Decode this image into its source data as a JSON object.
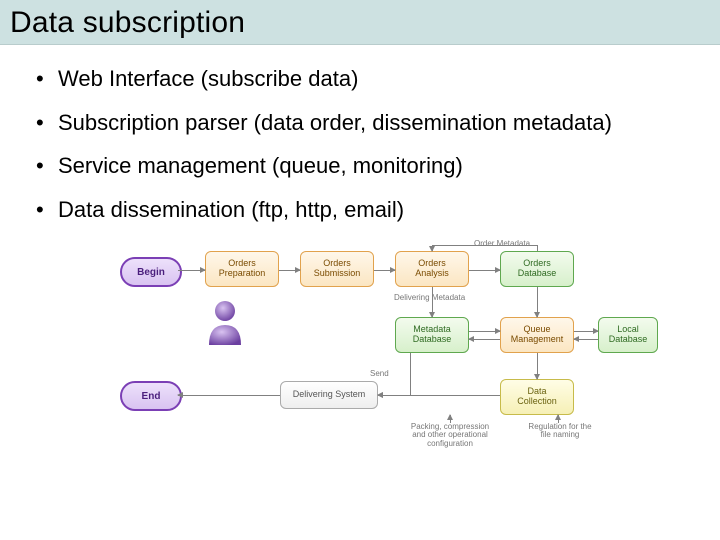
{
  "title": "Data subscription",
  "bullets": [
    "Web Interface (subscribe data)",
    "Subscription parser (data order, dissemination metadata)",
    "Service management (queue, monitoring)",
    "Data dissemination (ftp, http, email)"
  ],
  "diagram": {
    "begin": "Begin",
    "end": "End",
    "orders_preparation": "Orders Preparation",
    "orders_submission": "Orders Submission",
    "orders_analysis": "Orders Analysis",
    "orders_database": "Orders Database",
    "metadata_database": "Metadata Database",
    "queue_management": "Queue Management",
    "local_database": "Local Database",
    "delivering_system": "Delivering System",
    "data_collection": "Data Collection",
    "cap_order_metadata": "Order Metadata",
    "cap_delivering_metadata": "Delivering Metadata",
    "cap_send": "Send",
    "note_packing": "Packing, compression and other operational configuration",
    "note_regulation": "Regulation for the file naming"
  }
}
